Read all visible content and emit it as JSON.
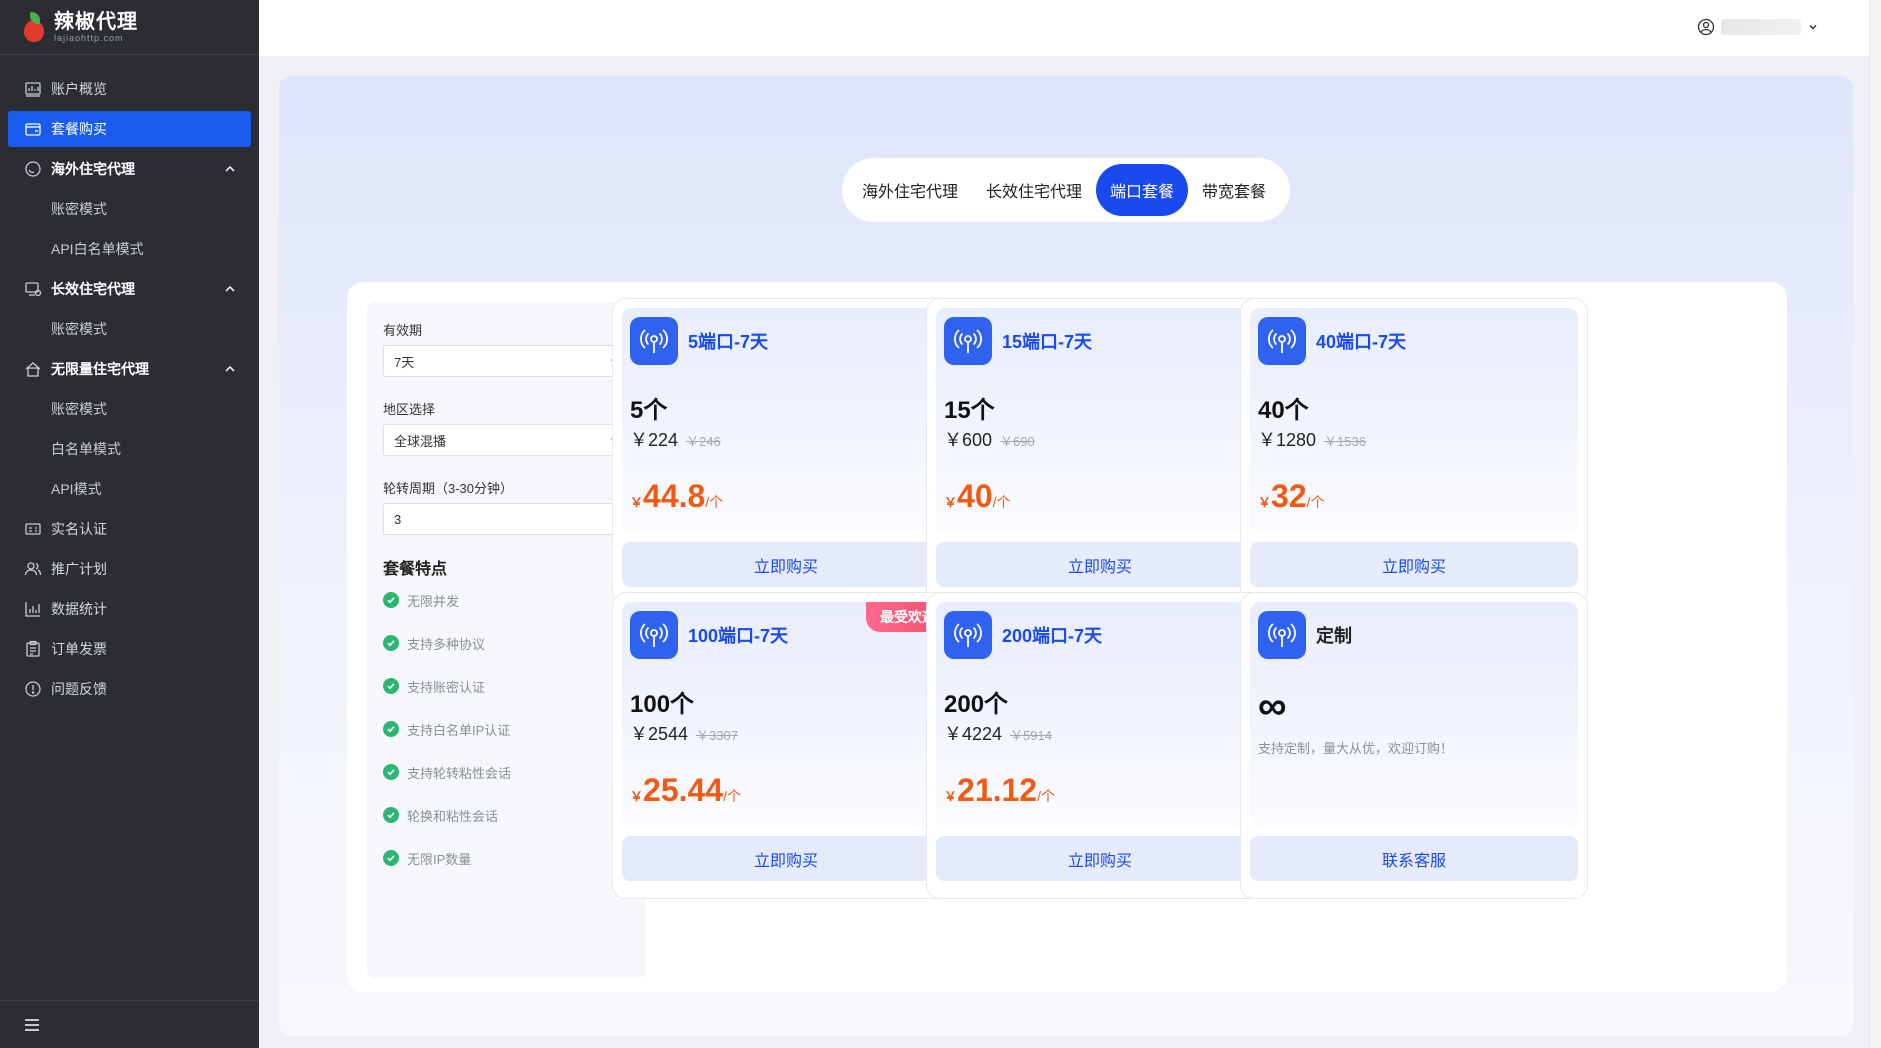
{
  "brand": {
    "name": "辣椒代理",
    "domain": "lajiaohttp.com"
  },
  "sidebar": {
    "items": [
      {
        "label": "账户概览",
        "icon": "dashboard-icon",
        "type": "item"
      },
      {
        "label": "套餐购买",
        "icon": "wallet-icon",
        "type": "item",
        "active": true
      },
      {
        "label": "海外住宅代理",
        "icon": "droplet-icon",
        "type": "group"
      },
      {
        "label": "账密模式",
        "type": "sub"
      },
      {
        "label": "API白名单模式",
        "type": "sub"
      },
      {
        "label": "长效住宅代理",
        "icon": "device-icon",
        "type": "group"
      },
      {
        "label": "账密模式",
        "type": "sub"
      },
      {
        "label": "无限量住宅代理",
        "icon": "home-icon",
        "type": "group"
      },
      {
        "label": "账密模式",
        "type": "sub"
      },
      {
        "label": "白名单模式",
        "type": "sub"
      },
      {
        "label": "API模式",
        "type": "sub"
      },
      {
        "label": "实名认证",
        "icon": "id-card-icon",
        "type": "item"
      },
      {
        "label": "推广计划",
        "icon": "users-icon",
        "type": "item"
      },
      {
        "label": "数据统计",
        "icon": "bar-chart-icon",
        "type": "item"
      },
      {
        "label": "订单发票",
        "icon": "clipboard-icon",
        "type": "item"
      },
      {
        "label": "问题反馈",
        "icon": "alert-circle-icon",
        "type": "item"
      }
    ]
  },
  "tabs": [
    {
      "label": "海外住宅代理"
    },
    {
      "label": "长效住宅代理"
    },
    {
      "label": "端口套餐",
      "active": true
    },
    {
      "label": "带宽套餐"
    }
  ],
  "filters": {
    "validity": {
      "label": "有效期",
      "value": "7天"
    },
    "region": {
      "label": "地区选择",
      "value": "全球混播"
    },
    "rotation": {
      "label": "轮转周期（3-30分钟）",
      "value": "3"
    }
  },
  "features": {
    "title": "套餐特点",
    "items": [
      "无限并发",
      "支持多种协议",
      "支持账密认证",
      "支持白名单IP认证",
      "支持轮转粘性会话",
      "轮换和粘性会话",
      "无限IP数量"
    ]
  },
  "packages": [
    {
      "title": "5端口-7天",
      "count": "5个",
      "price": "￥224",
      "orig": "￥246",
      "yen": "￥",
      "unit_price": "44.8",
      "per": "/个",
      "button": "立即购买"
    },
    {
      "title": "15端口-7天",
      "count": "15个",
      "price": "￥600",
      "orig": "￥690",
      "yen": "￥",
      "unit_price": "40",
      "per": "/个",
      "button": "立即购买"
    },
    {
      "title": "40端口-7天",
      "count": "40个",
      "price": "￥1280",
      "orig": "￥1536",
      "yen": "￥",
      "unit_price": "32",
      "per": "/个",
      "button": "立即购买"
    },
    {
      "title": "100端口-7天",
      "count": "100个",
      "price": "￥2544",
      "orig": "￥3307",
      "yen": "￥",
      "unit_price": "25.44",
      "per": "/个",
      "button": "立即购买",
      "badge": "最受欢迎"
    },
    {
      "title": "200端口-7天",
      "count": "200个",
      "price": "￥4224",
      "orig": "￥5914",
      "yen": "￥",
      "unit_price": "21.12",
      "per": "/个",
      "button": "立即购买"
    },
    {
      "title": "定制",
      "symbol": "∞",
      "desc": "支持定制，量大从优，欢迎订购！",
      "button": "联系客服"
    }
  ],
  "colors": {
    "accent": "#1a49f0",
    "price": "#f25a14",
    "sidebar": "#2b2d33",
    "check": "#2bb673"
  }
}
